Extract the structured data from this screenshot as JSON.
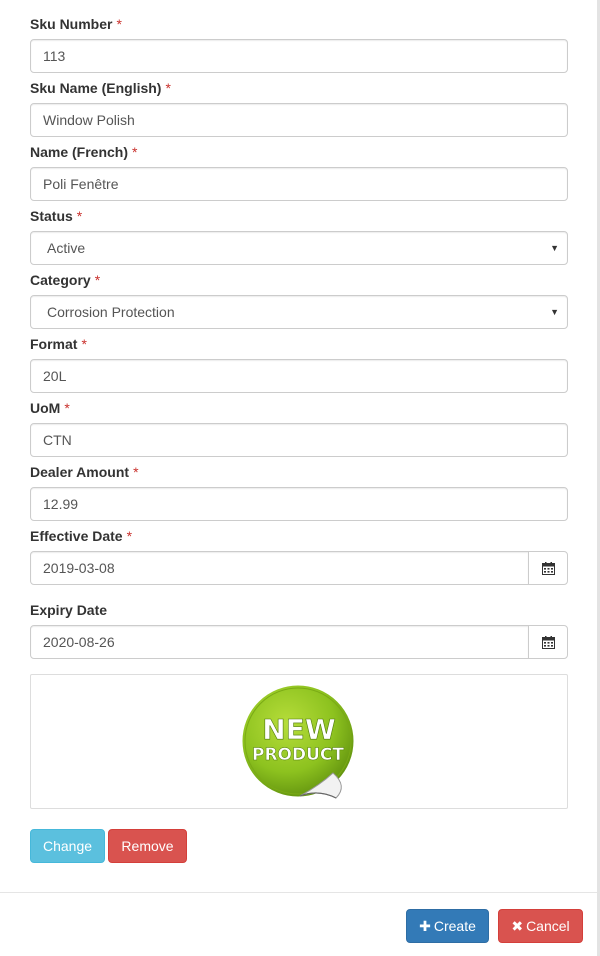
{
  "form": {
    "sku_number": {
      "label": "Sku Number",
      "value": "113"
    },
    "sku_name_en": {
      "label": "Sku Name (English)",
      "value": "Window Polish"
    },
    "name_fr": {
      "label": "Name (French)",
      "value": "Poli Fenêtre"
    },
    "status": {
      "label": "Status",
      "value": "Active"
    },
    "category": {
      "label": "Category",
      "value": "Corrosion Protection"
    },
    "format": {
      "label": "Format",
      "value": "20L"
    },
    "uom": {
      "label": "UoM",
      "value": "CTN"
    },
    "dealer_amount": {
      "label": "Dealer Amount",
      "value": "12.99"
    },
    "effective_date": {
      "label": "Effective Date",
      "value": "2019-03-08"
    },
    "expiry_date": {
      "label": "Expiry Date",
      "value": "2020-08-26"
    },
    "required_marker": "*"
  },
  "image": {
    "badge_line1": "NEW",
    "badge_line2": "PRODUCT",
    "badge_color": "#8dc21f"
  },
  "buttons": {
    "change": "Change",
    "remove": "Remove",
    "create": "Create",
    "create_icon": "✚",
    "cancel": "Cancel",
    "cancel_icon": "✖"
  },
  "colors": {
    "info": "#5bc0de",
    "danger": "#d9534f",
    "primary": "#337ab7",
    "required": "#c9302c"
  },
  "icons": {
    "date_picker": "calendar-icon",
    "select": "caret-down-icon"
  }
}
